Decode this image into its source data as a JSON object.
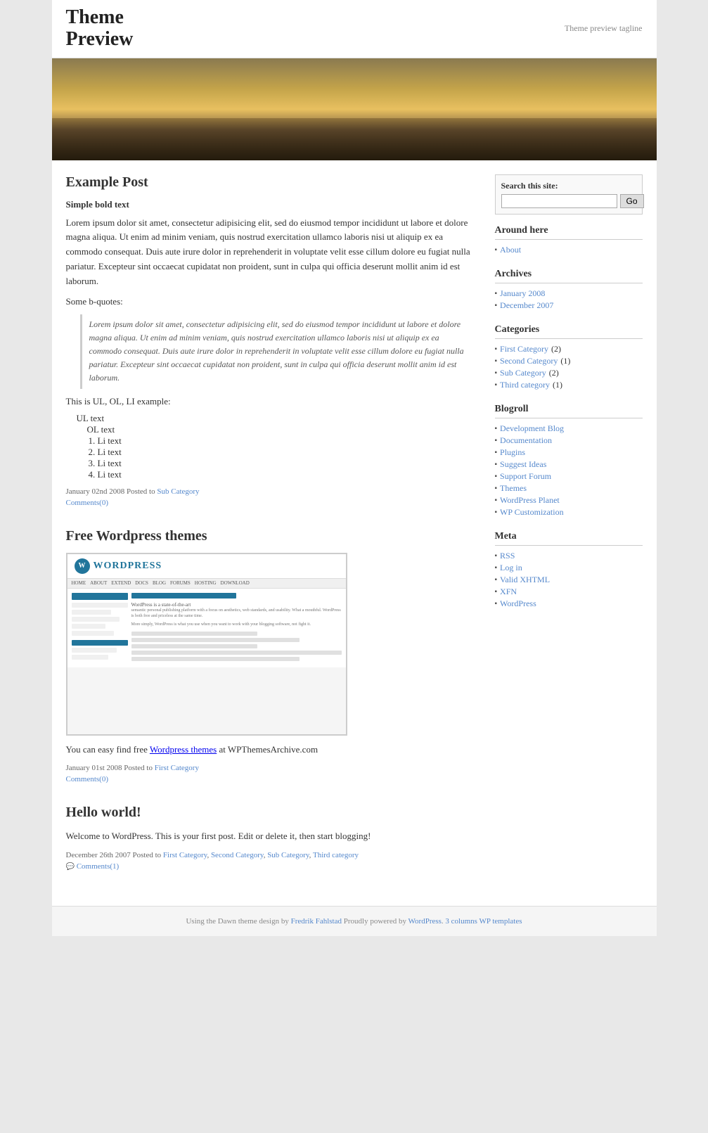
{
  "site": {
    "title": "Theme\nPreview",
    "tagline": "Theme preview tagline"
  },
  "sidebar": {
    "search_label": "Search this site:",
    "search_placeholder": "",
    "search_button": "Go",
    "around_here_title": "Around here",
    "around_here_links": [
      {
        "label": "About",
        "href": "#"
      }
    ],
    "archives_title": "Archives",
    "archives_links": [
      {
        "label": "January 2008",
        "href": "#"
      },
      {
        "label": "December 2007",
        "href": "#"
      }
    ],
    "categories_title": "Categories",
    "categories_links": [
      {
        "label": "First Category",
        "count": "(2)",
        "href": "#"
      },
      {
        "label": "Second Category",
        "count": "(1)",
        "href": "#"
      },
      {
        "label": "Sub Category",
        "count": "(2)",
        "href": "#"
      },
      {
        "label": "Third category",
        "count": "(1)",
        "href": "#"
      }
    ],
    "blogroll_title": "Blogroll",
    "blogroll_links": [
      {
        "label": "Development Blog",
        "href": "#"
      },
      {
        "label": "Documentation",
        "href": "#"
      },
      {
        "label": "Plugins",
        "href": "#"
      },
      {
        "label": "Suggest Ideas",
        "href": "#"
      },
      {
        "label": "Support Forum",
        "href": "#"
      },
      {
        "label": "Themes",
        "href": "#"
      },
      {
        "label": "WordPress Planet",
        "href": "#"
      },
      {
        "label": "WP Customization",
        "href": "#"
      }
    ],
    "meta_title": "Meta",
    "meta_links": [
      {
        "label": "RSS",
        "href": "#"
      },
      {
        "label": "Log in",
        "href": "#"
      },
      {
        "label": "Valid XHTML",
        "href": "#"
      },
      {
        "label": "XFN",
        "href": "#"
      },
      {
        "label": "WordPress",
        "href": "#"
      }
    ]
  },
  "posts": [
    {
      "title": "Example Post",
      "bold_heading": "Simple bold text",
      "body": "Lorem ipsum dolor sit amet, consectetur adipisicing elit, sed do eiusmod tempor incididunt ut labore et dolore magna aliqua. Ut enim ad minim veniam, quis nostrud exercitation ullamco laboris nisi ut aliquip ex ea commodo consequat. Duis aute irure dolor in reprehenderit in voluptate velit esse cillum dolore eu fugiat nulla pariatur. Excepteur sint occaecat cupidatat non proident, sunt in culpa qui officia deserunt mollit anim id est laborum.",
      "bquotes_label": "Some b-quotes:",
      "blockquote": "Lorem ipsum dolor sit amet, consectetur adipisicing elit, sed do eiusmod tempor incididunt ut labore et dolore magna aliqua. Ut enim ad minim veniam, quis nostrud exercitation ullamco laboris nisi ut aliquip ex ea commodo consequat. Duis aute irure dolor in reprehenderit in voluptate velit esse cillum dolore eu fugiat nulla pariatur. Excepteur sint occaecat cupidatat non proident, sunt in culpa qui officia deserunt mollit anim id est laborum.",
      "list_label": "This is UL, OL, LI example:",
      "ul_text": "UL text",
      "ol_text": "OL text",
      "li_items": [
        "Li text",
        "Li text",
        "Li text",
        "Li text"
      ],
      "meta": "January 02nd 2008 Posted to",
      "meta_category": "Sub Category",
      "comments": "Comments(0)"
    },
    {
      "title": "Free Wordpress themes",
      "body_prefix": "You can easy find free",
      "body_link": "Wordpress themes",
      "body_suffix": "at WPThemesArchive.com",
      "meta": "January 01st 2008 Posted to",
      "meta_category": "First Category",
      "comments": "Comments(0)"
    },
    {
      "title": "Hello world!",
      "body": "Welcome to WordPress. This is your first post. Edit or delete it, then start blogging!",
      "meta": "December 26th 2007 Posted to",
      "meta_categories": [
        "First Category",
        "Second Category",
        "Sub Category",
        "Third category"
      ],
      "comments": "Comments(1)"
    }
  ],
  "footer": {
    "text_prefix": "Using the Dawn theme design by",
    "author": "Fredrik Fahlstad",
    "text_middle": "Proudly powered by",
    "wp": "WordPress",
    "text_suffix": ".",
    "templates": "3 columns WP templates"
  }
}
